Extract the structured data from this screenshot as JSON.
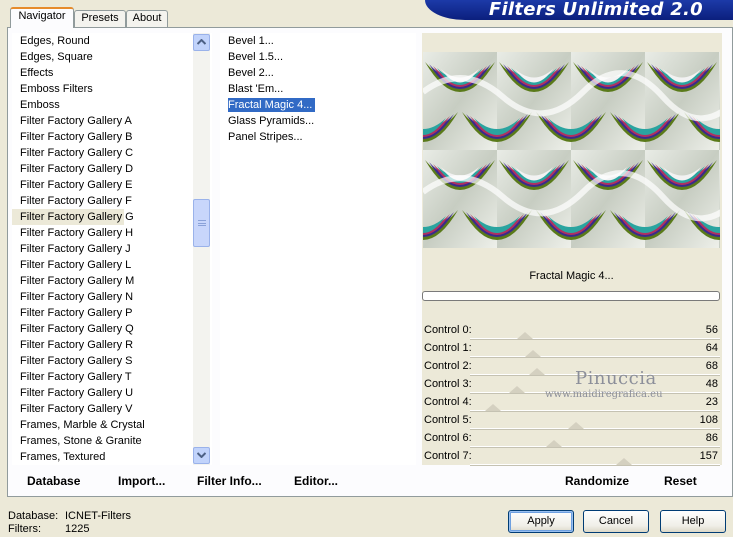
{
  "tabs": [
    {
      "label": "Navigator",
      "active": true
    },
    {
      "label": "Presets",
      "active": false
    },
    {
      "label": "About",
      "active": false
    }
  ],
  "banner": {
    "title": "Filters Unlimited 2.0"
  },
  "categories": [
    "Edges, Round",
    "Edges, Square",
    "Effects",
    "Emboss Filters",
    "Emboss",
    "Filter Factory Gallery A",
    "Filter Factory Gallery B",
    "Filter Factory Gallery C",
    "Filter Factory Gallery D",
    "Filter Factory Gallery E",
    "Filter Factory Gallery F",
    "Filter Factory Gallery G",
    "Filter Factory Gallery H",
    "Filter Factory Gallery J",
    "Filter Factory Gallery L",
    "Filter Factory Gallery M",
    "Filter Factory Gallery N",
    "Filter Factory Gallery P",
    "Filter Factory Gallery Q",
    "Filter Factory Gallery R",
    "Filter Factory Gallery S",
    "Filter Factory Gallery T",
    "Filter Factory Gallery U",
    "Filter Factory Gallery V",
    "Frames, Marble & Crystal",
    "Frames, Stone & Granite",
    "Frames, Textured"
  ],
  "selected_category": 11,
  "filters": [
    "Bevel 1...",
    "Bevel 1.5...",
    "Bevel 2...",
    "Blast 'Em...",
    "Fractal Magic 4...",
    "Glass Pyramids...",
    "Panel Stripes..."
  ],
  "selected_filter": 4,
  "preview": {
    "filter_name": "Fractal Magic 4...",
    "progress": 0
  },
  "controls": [
    {
      "label": "Control 0:",
      "value": 56
    },
    {
      "label": "Control 1:",
      "value": 64
    },
    {
      "label": "Control 2:",
      "value": 68
    },
    {
      "label": "Control 3:",
      "value": 48
    },
    {
      "label": "Control 4:",
      "value": 23
    },
    {
      "label": "Control 5:",
      "value": 108
    },
    {
      "label": "Control 6:",
      "value": 86
    },
    {
      "label": "Control 7:",
      "value": 157
    }
  ],
  "control_max": 255,
  "actions_left": {
    "database": "Database",
    "import": "Import...",
    "filter_info": "Filter Info...",
    "editor": "Editor..."
  },
  "actions_right": {
    "randomize": "Randomize",
    "reset": "Reset"
  },
  "status": {
    "database_label": "Database:",
    "database_value": "ICNET-Filters",
    "filters_label": "Filters:",
    "filters_value": "1225"
  },
  "buttons": {
    "apply": "Apply",
    "cancel": "Cancel",
    "help": "Help"
  },
  "watermark": {
    "name": "Pinuccia",
    "url": "www.maidiregrafica.eu"
  }
}
